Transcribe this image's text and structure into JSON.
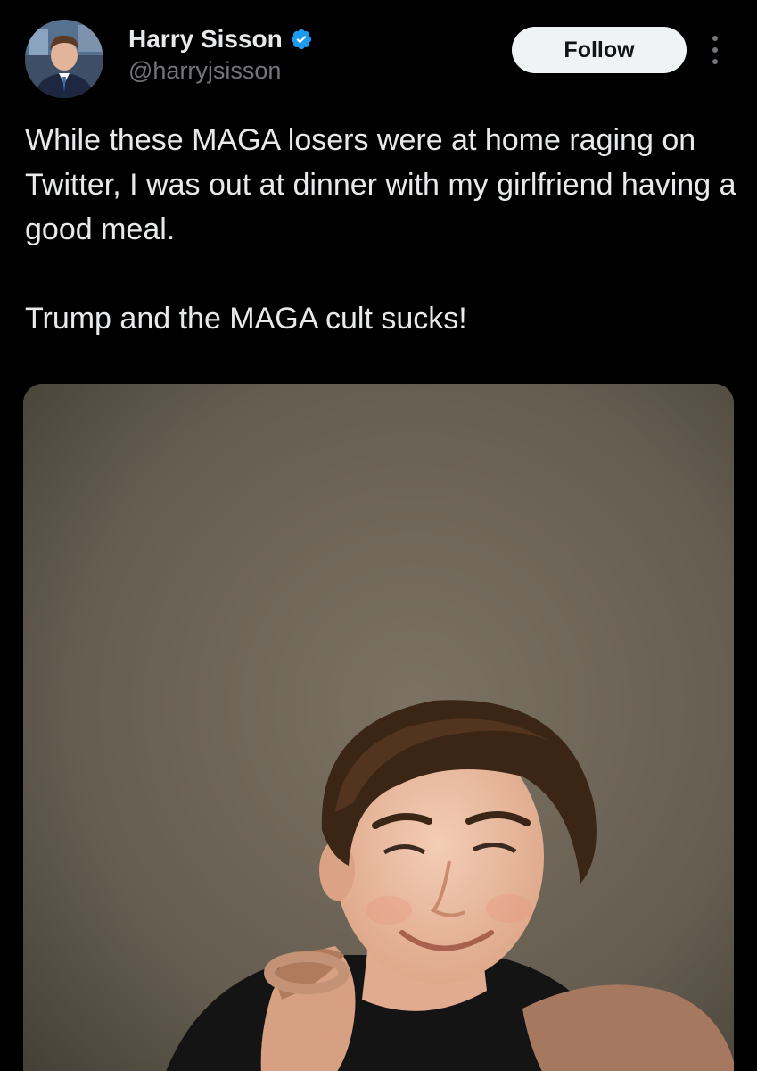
{
  "tweet": {
    "author": {
      "display_name": "Harry Sisson",
      "handle": "@harryjsisson",
      "verified": true,
      "verified_color": "#1d9bf0"
    },
    "follow_label": "Follow",
    "more_icon": "more-vertical-icon",
    "text_paragraphs": [
      "While these MAGA losers were at home raging on Twitter, I was out at dinner with my girlfriend having a good meal.",
      "Trump and the MAGA cult sucks!"
    ]
  },
  "colors": {
    "background": "#000000",
    "text_primary": "#e7e9ea",
    "text_secondary": "#71767b",
    "follow_bg": "#eff3f4"
  }
}
